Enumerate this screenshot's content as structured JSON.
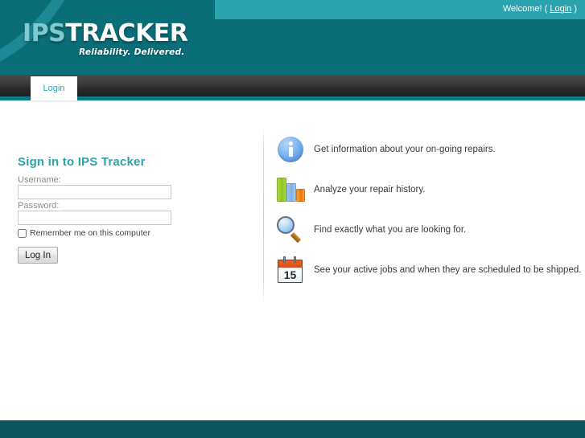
{
  "header": {
    "welcome_text": "Welcome!",
    "paren_open": "(",
    "login_link": "Login",
    "paren_close": ")",
    "logo_primary": "IPS",
    "logo_secondary": "TRACKER",
    "tagline": "Reliability. Delivered.",
    "colors": {
      "teal_dark": "#0A6E78",
      "teal_light": "#2AA3AE",
      "teal_accent": "#0A7A86",
      "footer": "#0A5560"
    }
  },
  "nav": {
    "tabs": [
      {
        "label": "Login",
        "active": true
      }
    ]
  },
  "login_form": {
    "title": "Sign in to IPS Tracker",
    "username_label": "Username:",
    "username_value": "",
    "username_placeholder": "",
    "password_label": "Password:",
    "password_value": "",
    "password_placeholder": "",
    "remember_label": "Remember me on this computer",
    "remember_checked": false,
    "submit_label": "Log In"
  },
  "features": [
    {
      "icon": "info-icon",
      "text": "Get information about your on-going repairs."
    },
    {
      "icon": "bar-chart-icon",
      "text": "Analyze your repair history."
    },
    {
      "icon": "magnifier-icon",
      "text": "Find exactly what you are looking for."
    },
    {
      "icon": "calendar-icon",
      "text": "See your active jobs and when they are scheduled to be shipped.",
      "calendar_day": "15"
    }
  ]
}
